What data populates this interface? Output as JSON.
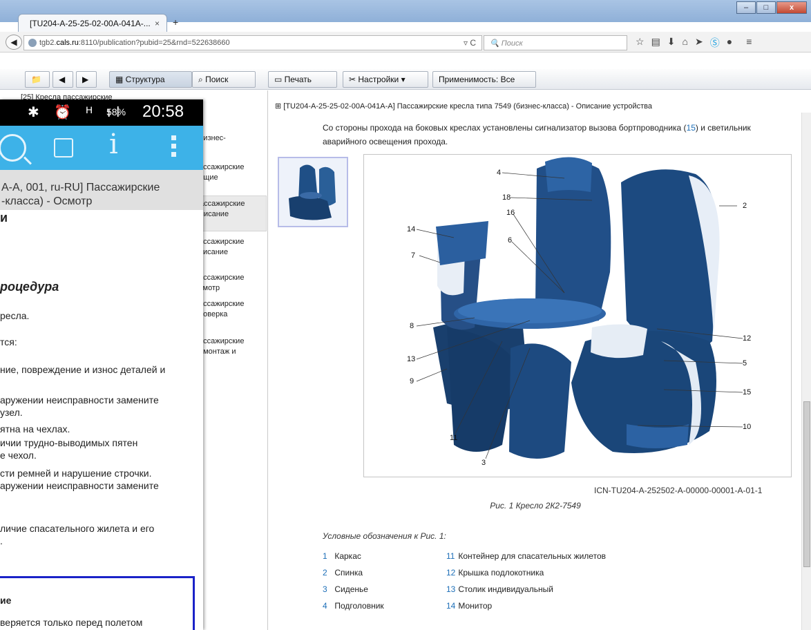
{
  "browser": {
    "tab_title": "[TU204-A-25-25-02-00A-041A-...",
    "tab_close": "×",
    "new_tab": "+",
    "window_controls": {
      "minimize": "–",
      "maximize": "□",
      "close": "x"
    },
    "url_prefix": "tgb2.",
    "url_host": "cals.ru",
    "url_rest": ":8110/publication?pubid=25&rnd=522638660",
    "search_placeholder": "Поиск",
    "toolbar_icons": [
      "star-icon",
      "reading-list-icon",
      "download-icon",
      "home-icon",
      "send-icon",
      "skype-icon",
      "chat-icon",
      "menu-icon"
    ]
  },
  "app_toolbar": {
    "structure": "Структура",
    "search": "Поиск",
    "print": "Печать",
    "settings": "Настройки",
    "applicability": "Применимость: Все"
  },
  "tree": {
    "top_item": "[25] Кресла пассажирские",
    "items": [
      "бизнес-",
      "ассажирские\nбщие",
      "ассажирские\nписание",
      "ассажирские\nписание",
      "ассажирские\nсмотр",
      "ассажирские\nроверка",
      "ассажирские\nемонтаж и"
    ]
  },
  "document": {
    "header": "⊞ [TU204-A-25-25-02-00A-041A-A] Пассажирские кресла типа 7549 (бизнес-класса) - Описание устройства",
    "para_before": "Со стороны прохода на боковых креслах установлены сигнализатор вызова бортпроводника (",
    "para_link": "15",
    "para_after": ") и светильник аварийного освещения прохода.",
    "figure_id": "ICN-TU204-A-252502-A-00000-00001-A-01-1",
    "figure_caption": "Рис. 1   Кресло 2К2-7549",
    "legend_title": "Условные обозначения к Рис. 1:",
    "legend_left": [
      {
        "num": "1",
        "label": "Каркас"
      },
      {
        "num": "2",
        "label": "Спинка"
      },
      {
        "num": "3",
        "label": "Сиденье"
      },
      {
        "num": "4",
        "label": "Подголовник"
      }
    ],
    "legend_right": [
      {
        "num": "11",
        "label": "Контейнер для спасательных жилетов"
      },
      {
        "num": "12",
        "label": "Крышка подлокотника"
      },
      {
        "num": "13",
        "label": "Столик индивидуальный"
      },
      {
        "num": "14",
        "label": "Монитор"
      }
    ],
    "callouts": [
      "4",
      "18",
      "16",
      "2",
      "14",
      "6",
      "7",
      "8",
      "12",
      "13",
      "5",
      "9",
      "15",
      "10",
      "11",
      "3"
    ]
  },
  "phone": {
    "status_icons": "✱ ⏰ ᴴ ıl",
    "battery": "58%",
    "time": "20:58",
    "title_line1": "A-A, 001, ru-RU] Пассажирские",
    "title_line2": "-класса) - Осмотр",
    "lines": [
      "и",
      "роцедура",
      "ресла.",
      "тся:",
      "ние, повреждение и износ деталей и",
      "аружении неисправности замените",
      "узел.",
      "ятна на чехлах.",
      "ичии трудно-выводимых пятен",
      "е чехол.",
      "сти ремней и нарушение строчки.",
      "аружении неисправности замените",
      "личие спасательного жилета и его",
      ".",
      "ие",
      "веряется только перед полетом"
    ]
  },
  "colors": {
    "accent": "#3db2e8",
    "link": "#1d6fb8",
    "note_border": "#1a22c8"
  }
}
